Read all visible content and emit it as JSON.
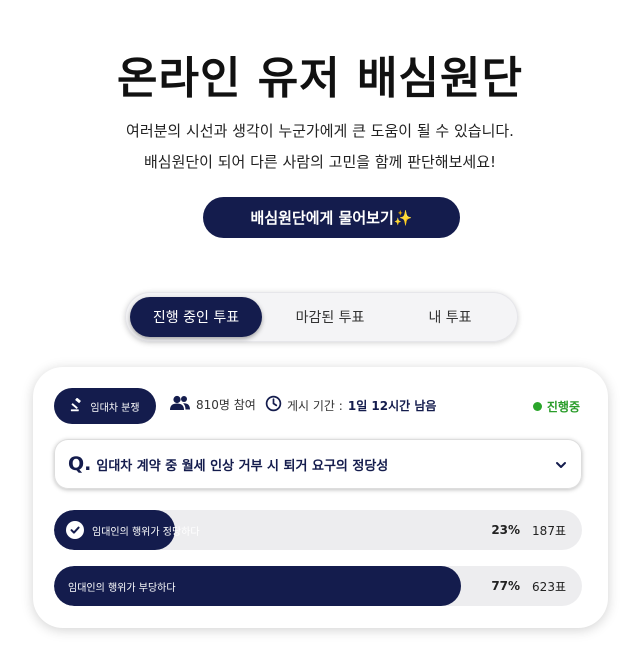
{
  "hero": {
    "title": "온라인 유저 배심원단",
    "subtitle_line1": "여러분의 시선과 생각이 누군가에게 큰 도움이 될 수 있습니다.",
    "subtitle_line2": "배심원단이 되어 다른 사람의 고민을 함께 판단해보세요!",
    "ask_button": "배심원단에게 물어보기✨"
  },
  "tabs": [
    {
      "label": "진행 중인 투표",
      "active": true
    },
    {
      "label": "마감된 투표",
      "active": false
    },
    {
      "label": "내 투표",
      "active": false
    }
  ],
  "vote_card": {
    "category": "임대차 분쟁",
    "participants": "810명 참여",
    "period_label": "게시 기간 :",
    "period_value": "1일 12시간 남음",
    "status": "진행중",
    "question_prefix": "Q.",
    "question": "임대차 계약 중 월세 인상 거부 시 퇴거 요구의 정당성",
    "options": [
      {
        "label": "임대인의 행위가 정당하다",
        "percent": "23%",
        "votes": "187표",
        "fraction": 0.23,
        "selected": true
      },
      {
        "label": "임대인의 행위가 부당하다",
        "percent": "77%",
        "votes": "623표",
        "fraction": 0.77,
        "selected": false
      }
    ]
  },
  "colors": {
    "primary": "#141c4d",
    "status_green": "#2a9d2a",
    "bar_bg": "#ededef"
  },
  "icons": {
    "category": "gavel-icon",
    "participants": "users-icon",
    "period": "clock-icon",
    "expand": "chevron-down-icon",
    "selected": "check-icon"
  }
}
